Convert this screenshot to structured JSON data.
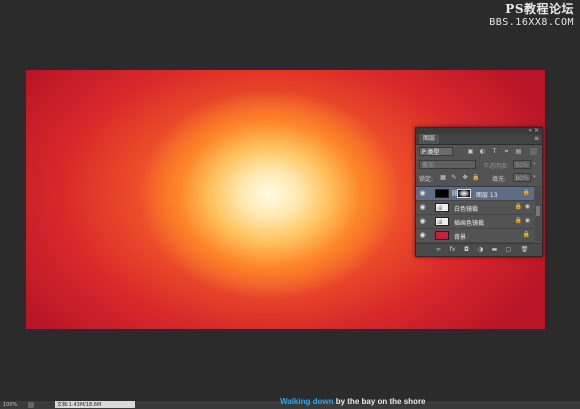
{
  "watermark": {
    "line1": "PS教程论坛",
    "line2": "BBS.16XX8.COM"
  },
  "canvas": {
    "colors": {
      "edge": "#b91528",
      "mid": "#f0542a",
      "glow": "#ffc35f",
      "core": "#fffbe5"
    }
  },
  "layers_panel": {
    "tab_label": "图层",
    "collapse_icon": "double-chevron-icon",
    "close_icon": "close-icon",
    "menu_icon": "panel-menu-icon",
    "filter": {
      "kind_label": "P 类型",
      "icons": [
        "image-filter-icon",
        "adjustment-filter-icon",
        "type-filter-icon",
        "shape-filter-icon",
        "smart-object-filter-icon"
      ]
    },
    "blend_mode": "叠加",
    "opacity_label": "不透明度:",
    "opacity_value": "80%",
    "lock_label": "锁定:",
    "fill_label": "填充:",
    "fill_value": "80%",
    "layers": [
      {
        "name": "图层 13",
        "selected": true,
        "thumbnail": "black",
        "has_mask": true
      },
      {
        "name": "白色镜裁",
        "selected": false,
        "thumbnail": "adjustment"
      },
      {
        "name": "插画色镜裁",
        "selected": false,
        "thumbnail": "adjustment"
      },
      {
        "name": "背景",
        "selected": false,
        "thumbnail": "red",
        "locked": true
      }
    ],
    "footer_icons": [
      "link-layers-icon",
      "fx-icon",
      "add-mask-icon",
      "new-adjustment-icon",
      "new-group-icon",
      "new-layer-icon",
      "delete-icon"
    ]
  },
  "statusbar": {
    "zoom": "100%",
    "doc_size": "文档:1.43M/18.6M"
  },
  "lyric": {
    "highlighted": "Walking down",
    "rest": " by the bay on the shore"
  }
}
